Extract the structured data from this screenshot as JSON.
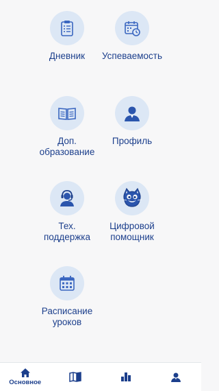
{
  "tiles": {
    "diary": {
      "label": "Дневник",
      "icon": "clipboard-checklist-icon"
    },
    "progress": {
      "label": "Успеваемость",
      "icon": "calendar-clock-icon"
    },
    "extra_education": {
      "label": "Доп.\nобразование",
      "icon": "open-book-icon"
    },
    "profile": {
      "label": "Профиль",
      "icon": "user-avatar-icon"
    },
    "support": {
      "label": "Тех.\nподдержка",
      "icon": "headset-operator-icon"
    },
    "assistant": {
      "label": "Цифровой\nпомощник",
      "icon": "cat-mascot-icon"
    },
    "schedule": {
      "label": "Расписание\nуроков",
      "icon": "calendar-grid-icon"
    }
  },
  "bottom_nav": {
    "home": {
      "label": "Основное",
      "icon": "home-icon",
      "active": true
    },
    "library": {
      "icon": "book-map-icon"
    },
    "stats": {
      "icon": "bar-chart-icon"
    },
    "account": {
      "icon": "user-icon"
    }
  },
  "colors": {
    "accent": "#1c3f8c",
    "circle_bg": "#dce7f5",
    "page_bg": "#f7f7f8"
  }
}
